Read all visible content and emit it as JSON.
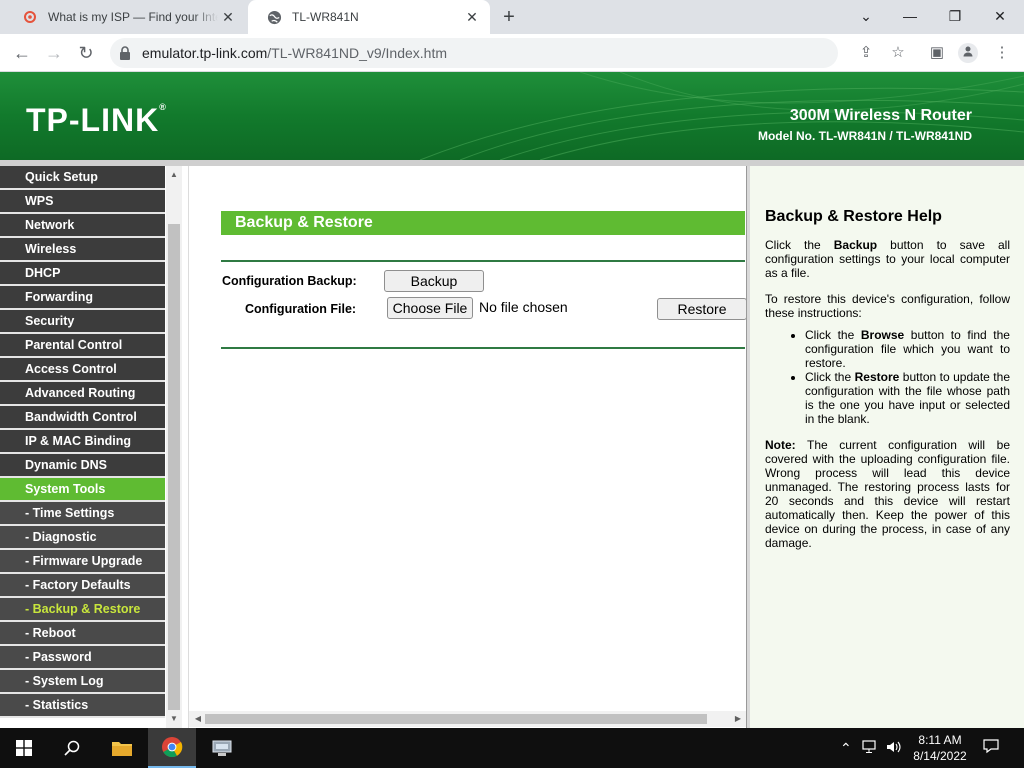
{
  "browser": {
    "tabs": [
      {
        "title": "What is my ISP — Find your Internet",
        "active": false
      },
      {
        "title": "TL-WR841N",
        "active": true
      }
    ],
    "url_host": "emulator.tp-link.com",
    "url_path": "/TL-WR841ND_v9/Index.htm"
  },
  "router_header": {
    "brand": "TP-LINK",
    "trademark": "®",
    "product_name": "300M Wireless N Router",
    "model": "Model No. TL-WR841N / TL-WR841ND"
  },
  "menu": {
    "items": [
      {
        "label": "Quick Setup",
        "type": "main"
      },
      {
        "label": "WPS",
        "type": "main"
      },
      {
        "label": "Network",
        "type": "main"
      },
      {
        "label": "Wireless",
        "type": "main"
      },
      {
        "label": "DHCP",
        "type": "main"
      },
      {
        "label": "Forwarding",
        "type": "main"
      },
      {
        "label": "Security",
        "type": "main"
      },
      {
        "label": "Parental Control",
        "type": "main"
      },
      {
        "label": "Access Control",
        "type": "main"
      },
      {
        "label": "Advanced Routing",
        "type": "main"
      },
      {
        "label": "Bandwidth Control",
        "type": "main"
      },
      {
        "label": "IP & MAC Binding",
        "type": "main"
      },
      {
        "label": "Dynamic DNS",
        "type": "main"
      },
      {
        "label": "System Tools",
        "type": "active"
      },
      {
        "label": "- Time Settings",
        "type": "sub"
      },
      {
        "label": "- Diagnostic",
        "type": "sub"
      },
      {
        "label": "- Firmware Upgrade",
        "type": "sub"
      },
      {
        "label": "- Factory Defaults",
        "type": "sub"
      },
      {
        "label": "- Backup & Restore",
        "type": "current"
      },
      {
        "label": "- Reboot",
        "type": "sub"
      },
      {
        "label": "- Password",
        "type": "sub"
      },
      {
        "label": "- System Log",
        "type": "sub"
      },
      {
        "label": "- Statistics",
        "type": "sub"
      }
    ]
  },
  "main": {
    "title": "Backup & Restore",
    "backup_label": "Configuration Backup:",
    "backup_button": "Backup",
    "file_label": "Configuration File:",
    "choose_file_button": "Choose File",
    "file_status": "No file chosen",
    "restore_button": "Restore"
  },
  "help": {
    "title": "Backup & Restore Help",
    "p1_a": "Click the ",
    "p1_b": "Backup",
    "p1_c": " button to save all configuration settings to your local computer as a file.",
    "p2": "To restore this device's configuration, follow these instructions:",
    "li1_a": "Click the ",
    "li1_b": "Browse",
    "li1_c": " button to find the configuration file which you want to restore.",
    "li2_a": "Click the ",
    "li2_b": "Restore",
    "li2_c": " button to update the configuration with the file whose path is the one you have input or selected in the blank.",
    "note_a": "Note:",
    "note_b": " The current configuration will be covered with the uploading configuration file. Wrong process will lead this device unmanaged. The restoring process lasts for 20 seconds and this device will restart automatically then. Keep the power of this device on during the process, in case of any damage."
  },
  "taskbar": {
    "time": "8:11 AM",
    "date": "8/14/2022"
  },
  "colors": {
    "tplink_green": "#127a2c",
    "menu_active": "#5fbb32",
    "menu_current_text": "#c8e63c",
    "menu_bg": "#3c3c3c"
  }
}
